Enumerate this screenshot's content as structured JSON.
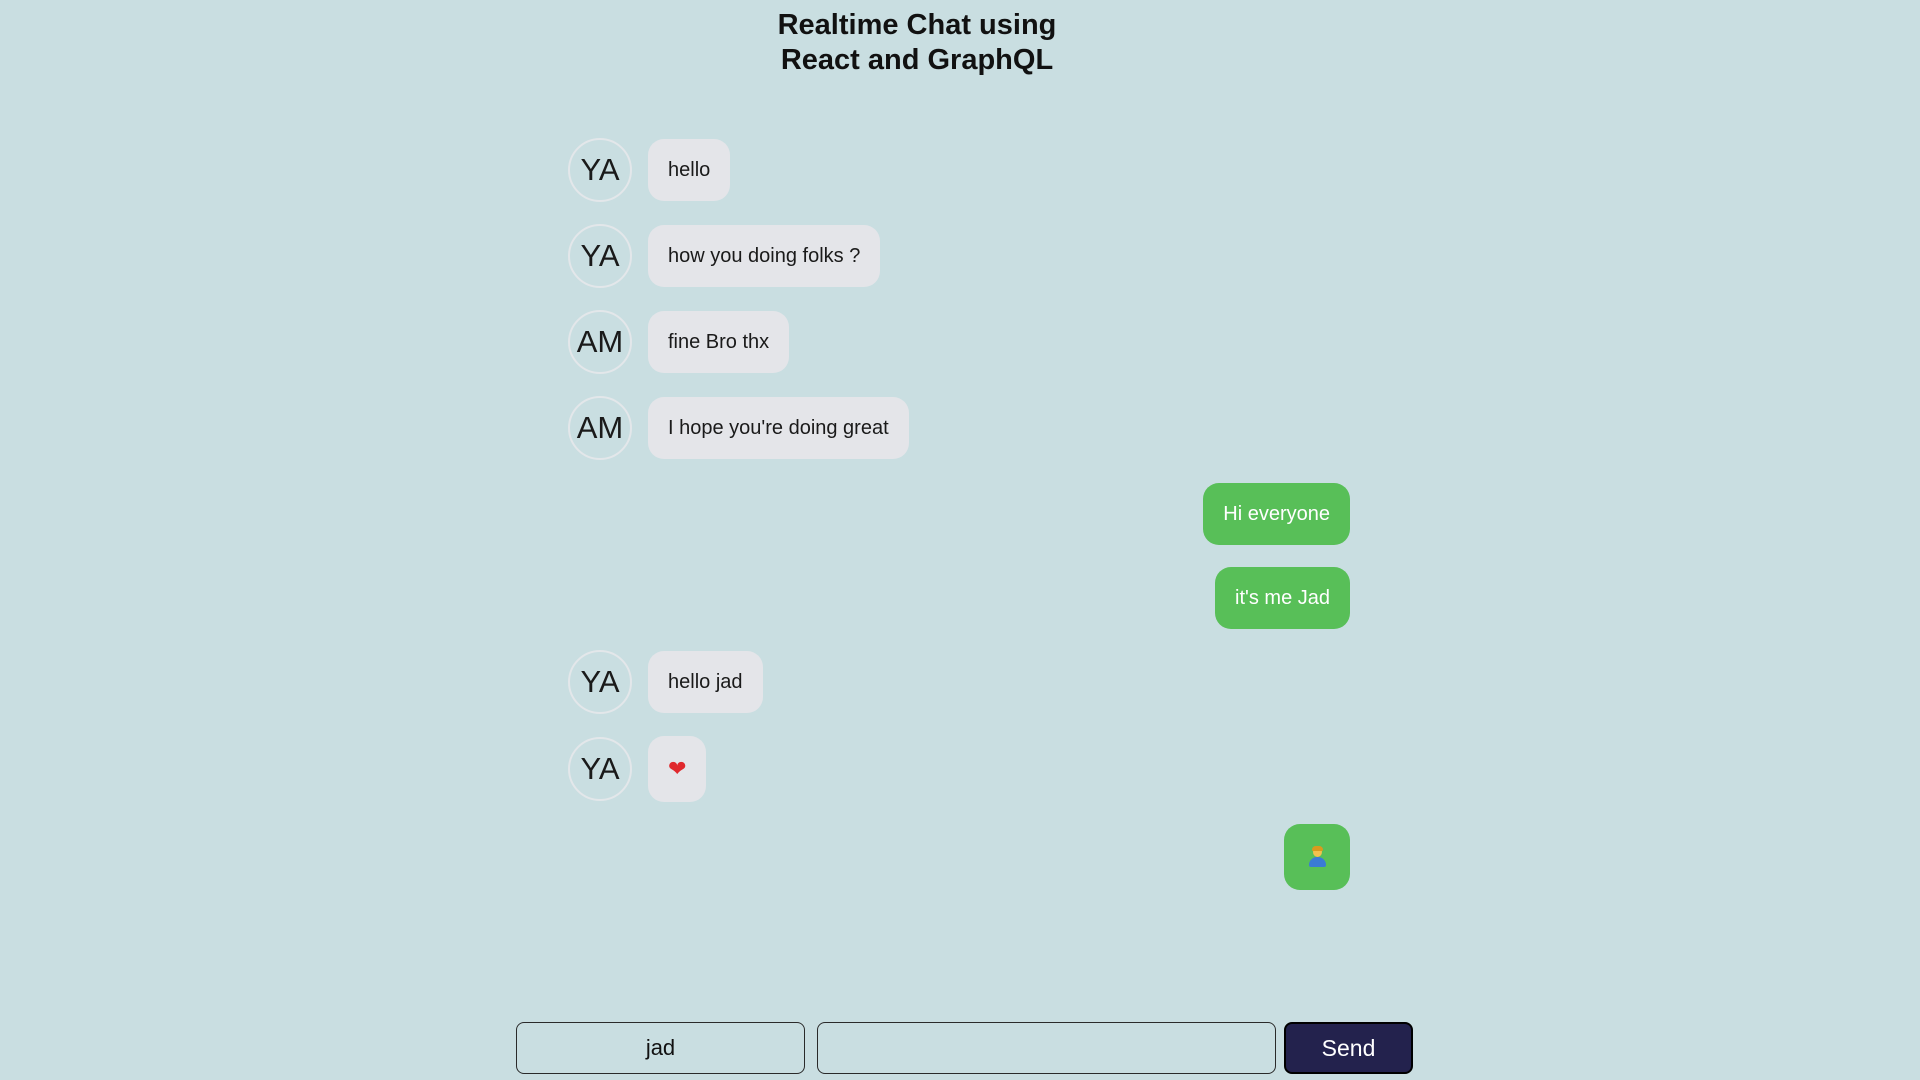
{
  "header": {
    "title_line1": "Realtime Chat using",
    "title_line2": "React and GraphQL"
  },
  "messages": [
    {
      "user": "YA",
      "text": "hello",
      "mine": false
    },
    {
      "user": "YA",
      "text": "how you doing folks ?",
      "mine": false
    },
    {
      "user": "AM",
      "text": "fine Bro thx",
      "mine": false
    },
    {
      "user": "AM",
      "text": "I hope you're doing great",
      "mine": false
    },
    {
      "user": "jad",
      "text": "Hi everyone",
      "mine": true
    },
    {
      "user": "jad",
      "text": "it's me Jad",
      "mine": true
    },
    {
      "user": "YA",
      "text": "hello jad",
      "mine": false
    },
    {
      "user": "YA",
      "icon": "heart-icon",
      "mine": false
    },
    {
      "user": "jad",
      "icon": "person-icon",
      "mine": true
    }
  ],
  "composer": {
    "username_value": "jad",
    "message_value": "",
    "send_label": "Send"
  },
  "colors": {
    "background": "#c9dee1",
    "incoming_bubble": "#e4e5e9",
    "outgoing_bubble": "#58bf58",
    "send_button": "#23224d",
    "heart": "#e0282d"
  }
}
